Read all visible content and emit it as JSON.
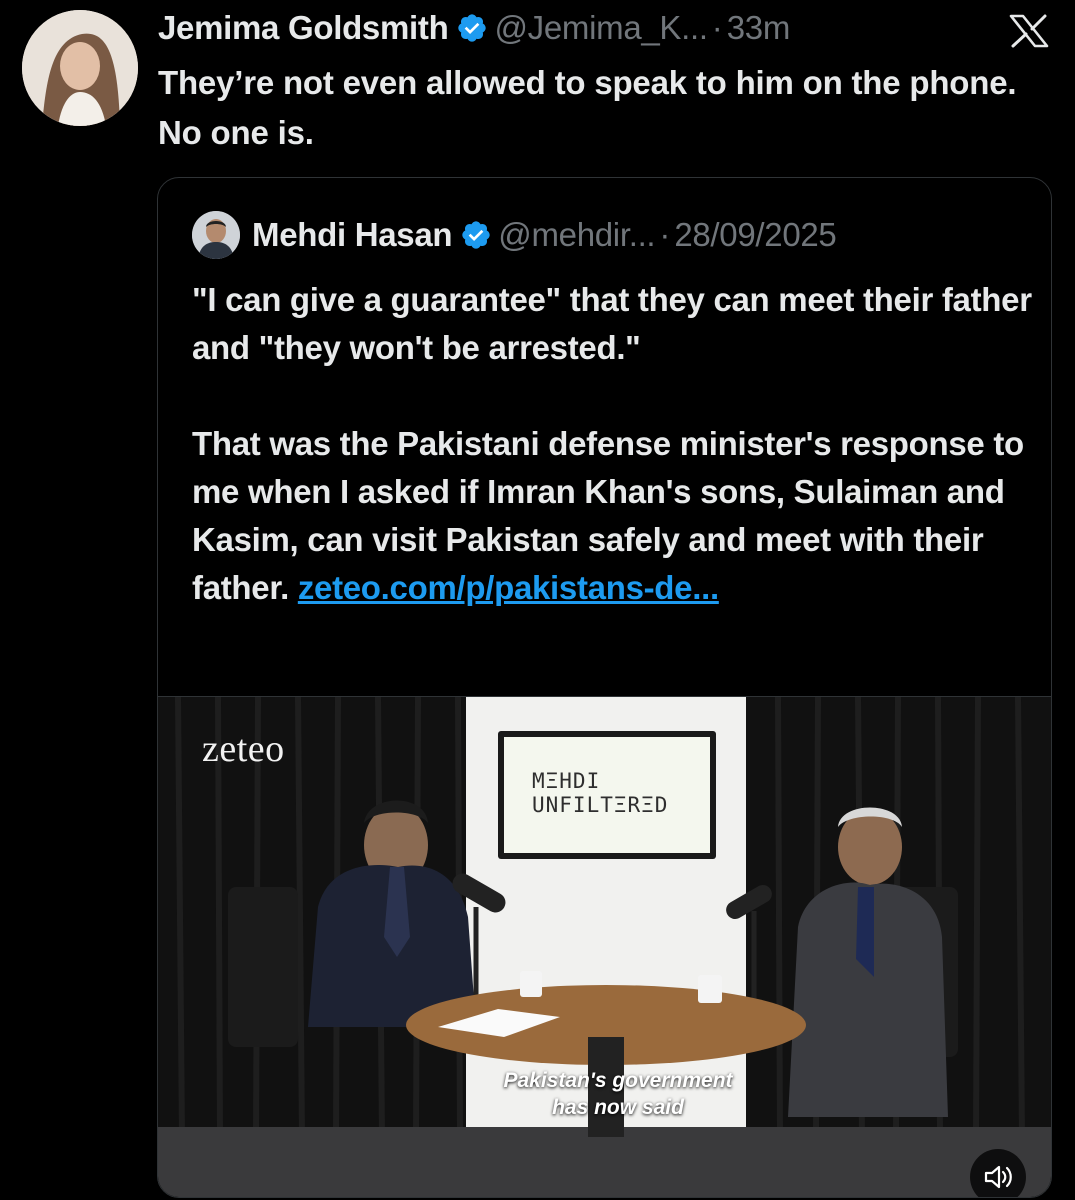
{
  "tweet": {
    "author": "Jemima Goldsmith",
    "handle": "@Jemima_K...",
    "separator": "·",
    "time": "33m",
    "text": "They’re not even allowed to speak to him on the phone. No one is."
  },
  "quoted_tweet": {
    "author": "Mehdi Hasan",
    "handle": "@mehdir...",
    "separator": "·",
    "date": "28/09/2025",
    "paragraph1": "\"I can give a guarantee\" that they can meet their father and \"they won't be arrested.\"",
    "paragraph2": "That was the Pakistani defense minister's response to me when I asked if Imran Khan's sons, Sulaiman and Kasim, can visit Pakistan safely and meet with their father.",
    "link": "zeteo.com/p/pakistans-de..."
  },
  "video": {
    "brand_logo": "zeteo",
    "screen_line1": "MΞHDI",
    "screen_line2": "UNFILTΞRΞD",
    "subtitle_line1": "Pakistan's government",
    "subtitle_line2": "has now said",
    "mute_icon": "speaker-muted-icon"
  },
  "icons": {
    "verified": "verified-badge-icon",
    "close": "x-close-icon"
  },
  "colors": {
    "background": "#000000",
    "text": "#e7e9ea",
    "secondary_text": "#71767b",
    "link": "#1d9bf0",
    "verified": "#1d9bf0",
    "border": "#2f3336"
  }
}
